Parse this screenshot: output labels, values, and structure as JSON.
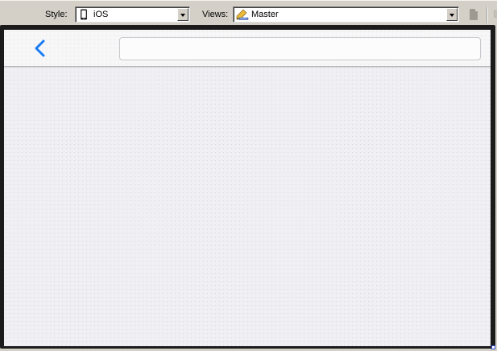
{
  "toolbar": {
    "style_label": "Style:",
    "style_value": "iOS",
    "views_label": "Views:",
    "views_value": "Master"
  },
  "icons": {
    "style": "phone-icon",
    "views": "pencil-ruler-icon",
    "toolbar_button": "document-icon",
    "back": "chevron-left-icon"
  },
  "colors": {
    "accent": "#1a7cf5",
    "frame": "#1b1b1b",
    "screen_background": "#f0eff4",
    "navbar_background": "#f7f7f8"
  },
  "navbar": {
    "title_value": ""
  }
}
